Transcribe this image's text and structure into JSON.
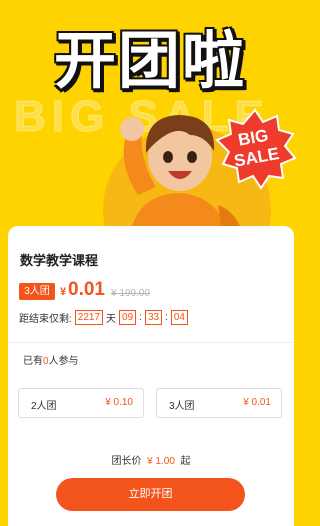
{
  "hero": {
    "title": "开团啦",
    "bg_text": "BIG SALE",
    "badge_line1": "BIG",
    "badge_line2": "SALE"
  },
  "course": {
    "title": "数学教学课程",
    "group_tag": "3人团",
    "currency": "¥",
    "price": "0.01",
    "original_price": "¥ 199.00"
  },
  "countdown": {
    "label": "距结束仅剩:",
    "days": "2217",
    "day_unit": "天",
    "hours": "09",
    "minutes": "33",
    "seconds": "04",
    "sep": ":"
  },
  "participants": {
    "prefix": "已有",
    "count": "0",
    "suffix": "人参与"
  },
  "group_options": [
    {
      "label": "2人团",
      "price": "¥ 0.10"
    },
    {
      "label": "3人团",
      "price": "¥ 0.01"
    }
  ],
  "leader_price": {
    "label": "团长价",
    "price": "¥ 1.00",
    "suffix": "起"
  },
  "cta": {
    "label": "立即开团"
  },
  "colors": {
    "accent": "#f2541b",
    "background": "#ffd300",
    "badge": "#ef3b2c"
  }
}
